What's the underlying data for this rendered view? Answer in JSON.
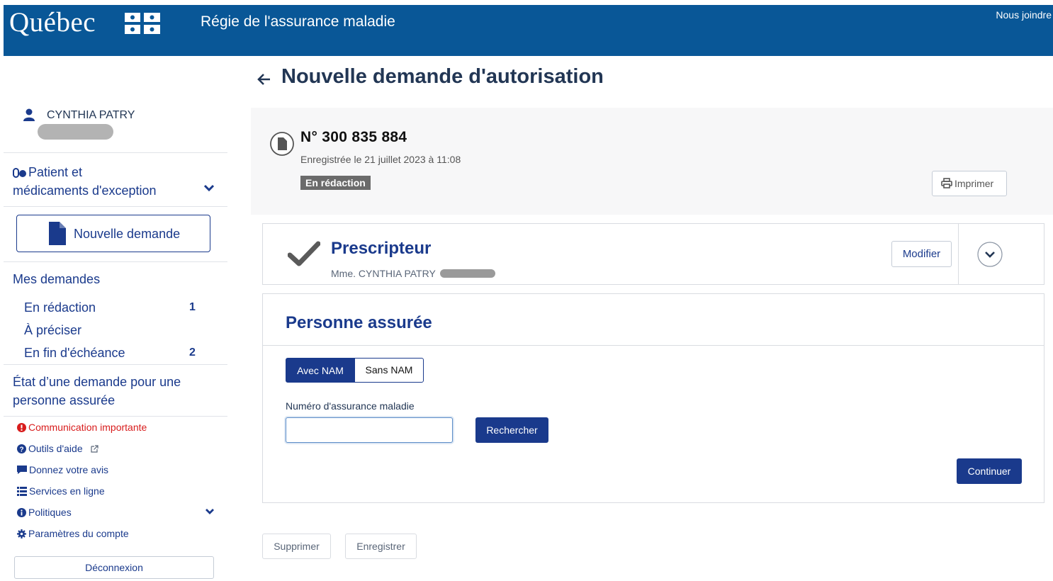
{
  "header": {
    "logo_text": "Québec",
    "agency": "Régie de l'assurance maladie",
    "contact_link": "Nous joindre",
    "color": "#095797"
  },
  "sidebar": {
    "user_name": "CYNTHIA PATRY",
    "patient_section": "Patient et médicaments d'exception",
    "new_request": "Nouvelle demande",
    "my_requests": "Mes demandes",
    "sub_items": [
      {
        "label": "En rédaction",
        "count": "1"
      },
      {
        "label": "À préciser",
        "count": ""
      },
      {
        "label": "En fin d'échéance",
        "count": "2"
      }
    ],
    "status_request": "État d’une demande pour une personne assurée",
    "utilities": [
      {
        "icon": "exclamation-circle-icon",
        "label": "Communication importante"
      },
      {
        "icon": "question-circle-icon",
        "label": "Outils d'aide"
      },
      {
        "icon": "comment-icon",
        "label": "Donnez votre avis"
      },
      {
        "icon": "list-icon",
        "label": "Services en ligne"
      },
      {
        "icon": "info-circle-icon",
        "label": "Politiques"
      },
      {
        "icon": "gear-icon",
        "label": "Paramètres du compte"
      }
    ],
    "logout": "Déconnexion"
  },
  "main": {
    "title": "Nouvelle demande d'autorisation",
    "request_number": "N° 300 835 884",
    "registered": "Enregistrée le 21 juillet 2023 à 11:08",
    "status": "En rédaction",
    "print": "Imprimer",
    "prescriber": {
      "title": "Prescripteur",
      "name": "Mme. CYNTHIA PATRY",
      "modify": "Modifier"
    },
    "insured": {
      "title": "Personne assurée",
      "toggle_with": "Avec NAM",
      "toggle_without": "Sans NAM",
      "field_label": "Numéro d'assurance maladie",
      "field_value": "",
      "search": "Rechercher",
      "continue": "Continuer"
    },
    "footer": {
      "delete": "Supprimer",
      "save": "Enregistrer"
    }
  },
  "colors": {
    "primary": "#1a3a8c",
    "alert": "#d81c1c",
    "badge": "#6b6b6b"
  }
}
